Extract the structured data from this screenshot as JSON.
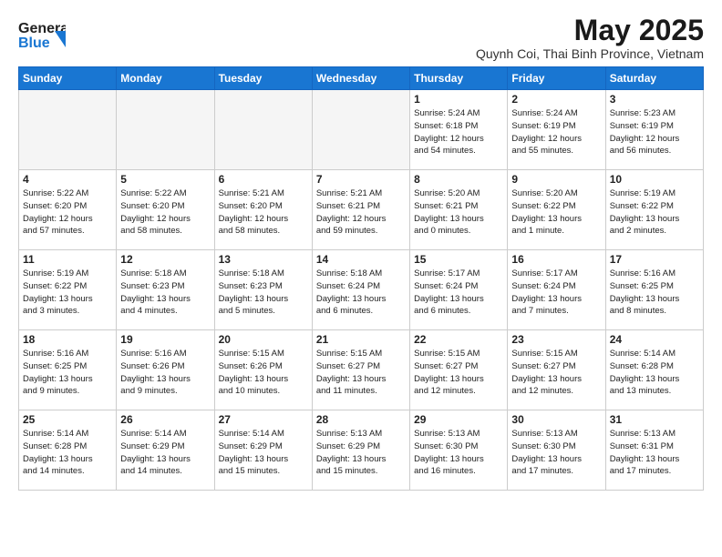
{
  "logo": {
    "line1": "General",
    "line2": "Blue"
  },
  "title": "May 2025",
  "location": "Quynh Coi, Thai Binh Province, Vietnam",
  "weekdays": [
    "Sunday",
    "Monday",
    "Tuesday",
    "Wednesday",
    "Thursday",
    "Friday",
    "Saturday"
  ],
  "weeks": [
    [
      {
        "day": "",
        "info": ""
      },
      {
        "day": "",
        "info": ""
      },
      {
        "day": "",
        "info": ""
      },
      {
        "day": "",
        "info": ""
      },
      {
        "day": "1",
        "info": "Sunrise: 5:24 AM\nSunset: 6:18 PM\nDaylight: 12 hours\nand 54 minutes."
      },
      {
        "day": "2",
        "info": "Sunrise: 5:24 AM\nSunset: 6:19 PM\nDaylight: 12 hours\nand 55 minutes."
      },
      {
        "day": "3",
        "info": "Sunrise: 5:23 AM\nSunset: 6:19 PM\nDaylight: 12 hours\nand 56 minutes."
      }
    ],
    [
      {
        "day": "4",
        "info": "Sunrise: 5:22 AM\nSunset: 6:20 PM\nDaylight: 12 hours\nand 57 minutes."
      },
      {
        "day": "5",
        "info": "Sunrise: 5:22 AM\nSunset: 6:20 PM\nDaylight: 12 hours\nand 58 minutes."
      },
      {
        "day": "6",
        "info": "Sunrise: 5:21 AM\nSunset: 6:20 PM\nDaylight: 12 hours\nand 58 minutes."
      },
      {
        "day": "7",
        "info": "Sunrise: 5:21 AM\nSunset: 6:21 PM\nDaylight: 12 hours\nand 59 minutes."
      },
      {
        "day": "8",
        "info": "Sunrise: 5:20 AM\nSunset: 6:21 PM\nDaylight: 13 hours\nand 0 minutes."
      },
      {
        "day": "9",
        "info": "Sunrise: 5:20 AM\nSunset: 6:22 PM\nDaylight: 13 hours\nand 1 minute."
      },
      {
        "day": "10",
        "info": "Sunrise: 5:19 AM\nSunset: 6:22 PM\nDaylight: 13 hours\nand 2 minutes."
      }
    ],
    [
      {
        "day": "11",
        "info": "Sunrise: 5:19 AM\nSunset: 6:22 PM\nDaylight: 13 hours\nand 3 minutes."
      },
      {
        "day": "12",
        "info": "Sunrise: 5:18 AM\nSunset: 6:23 PM\nDaylight: 13 hours\nand 4 minutes."
      },
      {
        "day": "13",
        "info": "Sunrise: 5:18 AM\nSunset: 6:23 PM\nDaylight: 13 hours\nand 5 minutes."
      },
      {
        "day": "14",
        "info": "Sunrise: 5:18 AM\nSunset: 6:24 PM\nDaylight: 13 hours\nand 6 minutes."
      },
      {
        "day": "15",
        "info": "Sunrise: 5:17 AM\nSunset: 6:24 PM\nDaylight: 13 hours\nand 6 minutes."
      },
      {
        "day": "16",
        "info": "Sunrise: 5:17 AM\nSunset: 6:24 PM\nDaylight: 13 hours\nand 7 minutes."
      },
      {
        "day": "17",
        "info": "Sunrise: 5:16 AM\nSunset: 6:25 PM\nDaylight: 13 hours\nand 8 minutes."
      }
    ],
    [
      {
        "day": "18",
        "info": "Sunrise: 5:16 AM\nSunset: 6:25 PM\nDaylight: 13 hours\nand 9 minutes."
      },
      {
        "day": "19",
        "info": "Sunrise: 5:16 AM\nSunset: 6:26 PM\nDaylight: 13 hours\nand 9 minutes."
      },
      {
        "day": "20",
        "info": "Sunrise: 5:15 AM\nSunset: 6:26 PM\nDaylight: 13 hours\nand 10 minutes."
      },
      {
        "day": "21",
        "info": "Sunrise: 5:15 AM\nSunset: 6:27 PM\nDaylight: 13 hours\nand 11 minutes."
      },
      {
        "day": "22",
        "info": "Sunrise: 5:15 AM\nSunset: 6:27 PM\nDaylight: 13 hours\nand 12 minutes."
      },
      {
        "day": "23",
        "info": "Sunrise: 5:15 AM\nSunset: 6:27 PM\nDaylight: 13 hours\nand 12 minutes."
      },
      {
        "day": "24",
        "info": "Sunrise: 5:14 AM\nSunset: 6:28 PM\nDaylight: 13 hours\nand 13 minutes."
      }
    ],
    [
      {
        "day": "25",
        "info": "Sunrise: 5:14 AM\nSunset: 6:28 PM\nDaylight: 13 hours\nand 14 minutes."
      },
      {
        "day": "26",
        "info": "Sunrise: 5:14 AM\nSunset: 6:29 PM\nDaylight: 13 hours\nand 14 minutes."
      },
      {
        "day": "27",
        "info": "Sunrise: 5:14 AM\nSunset: 6:29 PM\nDaylight: 13 hours\nand 15 minutes."
      },
      {
        "day": "28",
        "info": "Sunrise: 5:13 AM\nSunset: 6:29 PM\nDaylight: 13 hours\nand 15 minutes."
      },
      {
        "day": "29",
        "info": "Sunrise: 5:13 AM\nSunset: 6:30 PM\nDaylight: 13 hours\nand 16 minutes."
      },
      {
        "day": "30",
        "info": "Sunrise: 5:13 AM\nSunset: 6:30 PM\nDaylight: 13 hours\nand 17 minutes."
      },
      {
        "day": "31",
        "info": "Sunrise: 5:13 AM\nSunset: 6:31 PM\nDaylight: 13 hours\nand 17 minutes."
      }
    ]
  ]
}
